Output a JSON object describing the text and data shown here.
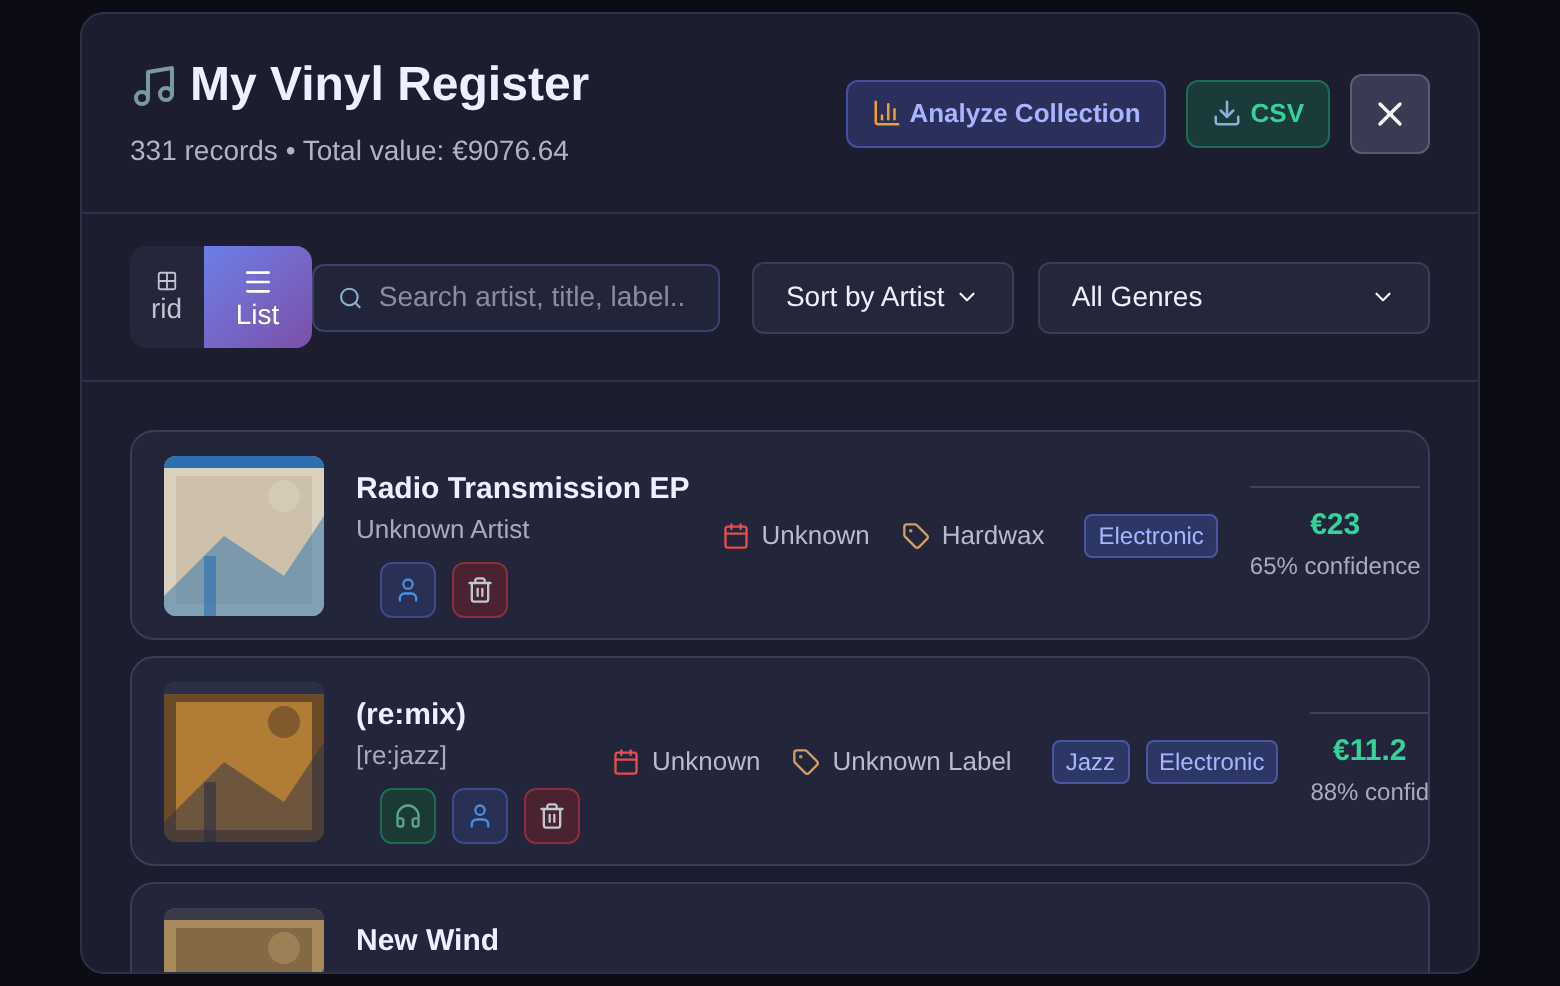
{
  "header": {
    "title": "My Vinyl Register",
    "subtitle": "331 records • Total value: €9076.64",
    "buttons": [
      {
        "kind": "analyze",
        "label": "Analyze Collection"
      },
      {
        "kind": "csv",
        "label": "CSV"
      }
    ]
  },
  "view_toggle": [
    {
      "label": "rid",
      "kind": "grid",
      "selected": false
    },
    {
      "label": "List",
      "kind": "list",
      "selected": true
    }
  ],
  "search": {
    "placeholder": "Search artist, title, label.."
  },
  "sort": {
    "value": "Sort by Artist"
  },
  "genre_filter": {
    "value": "All Genres"
  },
  "records": [
    {
      "title": "Radio Transmission EP",
      "artist": "Unknown Artist",
      "cover": {
        "kind": "picture"
      },
      "actions": [
        {
          "kind": "artist"
        },
        {
          "kind": "delete"
        }
      ],
      "year": "Unknown",
      "label": "Hardwax",
      "genres": [
        "Electronic"
      ],
      "price": "€23",
      "confidence": "65% confidence"
    },
    {
      "title": "(re:mix)",
      "artist": "[re:jazz]",
      "cover": {
        "kind": "picture"
      },
      "actions": [
        {
          "kind": "listen"
        },
        {
          "kind": "artist"
        },
        {
          "kind": "delete"
        }
      ],
      "year": "Unknown",
      "label": "Unknown Label",
      "genres": [
        "Jazz",
        "Electronic"
      ],
      "price": "€11.2",
      "confidence": "88% confid"
    },
    {
      "title": "New Wind",
      "cover": {
        "kind": "picture"
      }
    }
  ]
}
